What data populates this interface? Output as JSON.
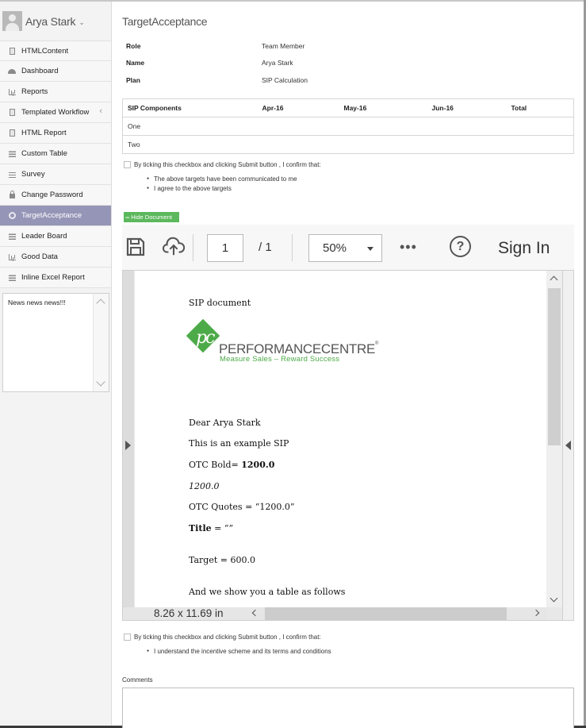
{
  "user": {
    "name": "Arya Stark"
  },
  "sidebar": {
    "items": [
      {
        "label": "HTMLContent",
        "icon": "document-icon"
      },
      {
        "label": "Dashboard",
        "icon": "gauge-icon"
      },
      {
        "label": "Reports",
        "icon": "bar-chart-icon"
      },
      {
        "label": "Templated Workflow",
        "icon": "document-icon",
        "has_chevron": true
      },
      {
        "label": "HTML Report",
        "icon": "document-icon"
      },
      {
        "label": "Custom Table",
        "icon": "table-icon"
      },
      {
        "label": "Survey",
        "icon": "list-icon"
      },
      {
        "label": "Change Password",
        "icon": "lock-icon"
      },
      {
        "label": "TargetAcceptance",
        "icon": "circle-icon",
        "active": true
      },
      {
        "label": "Leader Board",
        "icon": "table-icon"
      },
      {
        "label": "Good Data",
        "icon": "bar-chart-icon"
      },
      {
        "label": "Inline Excel Report",
        "icon": "table-icon"
      }
    ],
    "news": "News news news!!!"
  },
  "main": {
    "title": "TargetAcceptance",
    "info": [
      {
        "key": "Role",
        "value": "Team Member"
      },
      {
        "key": "Name",
        "value": "Arya Stark"
      },
      {
        "key": "Plan",
        "value": "SIP Calculation"
      }
    ],
    "sip_table": {
      "headers": [
        "SIP Components",
        "Apr-16",
        "May-16",
        "Jun-16",
        "Total"
      ],
      "rows": [
        [
          "One",
          "",
          "",
          "",
          ""
        ],
        [
          "Two",
          "",
          "",
          "",
          ""
        ]
      ]
    },
    "confirm1": {
      "text": "By ticking this checkbox and clicking Submit button , I confirm that:",
      "bullets": [
        "The above targets have been communicated to me",
        "I agree to the above targets"
      ]
    },
    "hide_button": "Hide Document",
    "pdf": {
      "page_current": "1",
      "page_total": "/ 1",
      "zoom": "50%",
      "more": "•••",
      "help": "?",
      "sign_in": "Sign In",
      "page_size": "8.26 x 11.69 in",
      "doc_title": "SIP document",
      "logo": {
        "mark": "pc",
        "name": "PERFORMANCECENTRE",
        "tm": "®",
        "tagline": "Measure Sales – Reward Success"
      },
      "lines": {
        "greeting": "Dear Arya Stark",
        "intro": "This is an example SIP",
        "otc_bold_label": "OTC Bold= ",
        "otc_bold_value": "1200.0",
        "otc_italic": "1200.0",
        "otc_quotes": "OTC Quotes = “1200.0”",
        "title_label": "Title",
        "title_rest": " = “”",
        "target": "Target = 600.0",
        "table_intro": "And we show you a table as follows"
      }
    },
    "confirm2": {
      "text": "By ticking this checkbox and clicking Submit button , I confirm that:",
      "bullets": [
        "I understand the incentive scheme and its terms and conditions"
      ]
    },
    "comments_label": "Comments"
  },
  "colors": {
    "active_menu": "#9595b7",
    "hide_button": "#5cb85c",
    "logo_green": "#4daa48"
  }
}
